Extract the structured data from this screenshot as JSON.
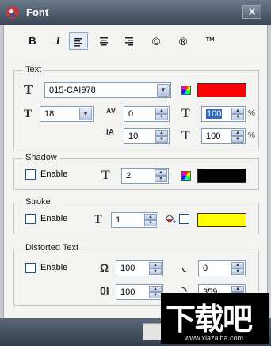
{
  "window": {
    "title": "Font",
    "close_glyph": "X"
  },
  "toolbar": {
    "bold": "B",
    "italic": "I",
    "align_left_icon": "align-left-icon",
    "align_center_icon": "align-center-icon",
    "align_right_icon": "align-right-icon",
    "copyright": "©",
    "registered": "®",
    "trademark": "™"
  },
  "text_group": {
    "title": "Text",
    "font_name": "015-CAI978",
    "font_color": "#ff0000",
    "font_size": "18",
    "char_spacing": "0",
    "scale_x": "100",
    "scale_x_unit": "%",
    "line_spacing": "10",
    "scale_y": "100",
    "scale_y_unit": "%",
    "av_label": "AV"
  },
  "shadow_group": {
    "title": "Shadow",
    "enable_label": "Enable",
    "enabled": false,
    "offset": "2",
    "color": "#000000"
  },
  "stroke_group": {
    "title": "Stroke",
    "enable_label": "Enable",
    "enabled": false,
    "width": "1",
    "fill_enabled": false,
    "color": "#ffff00"
  },
  "distort_group": {
    "title": "Distorted Text",
    "enable_label": "Enable",
    "enabled": false,
    "value_a": "100",
    "value_b": "0",
    "value_c": "100",
    "value_d": "359"
  },
  "watermark": {
    "main_text": "下载吧",
    "url": "www.xiazaiba.com"
  },
  "colors": {
    "titlebar": "#4b5868",
    "client_bg": "#f3f3f1"
  }
}
